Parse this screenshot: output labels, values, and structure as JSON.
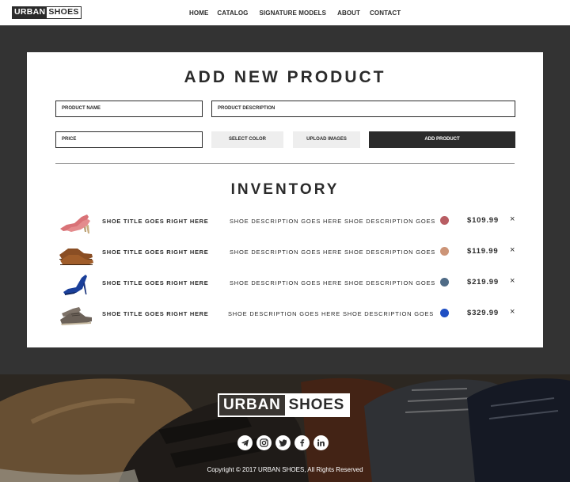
{
  "brand": {
    "part1": "URBAN",
    "part2": "SHOES"
  },
  "nav": {
    "items": [
      "HOME",
      "CATALOG",
      "SIGNATURE MODELS",
      "ABOUT",
      "CONTACT"
    ]
  },
  "add_form": {
    "title": "ADD NEW PRODUCT",
    "product_name_placeholder": "PRODUCT NAME",
    "product_description_placeholder": "PRODUCT DESCRIPTION",
    "price_placeholder": "PRICE",
    "select_color_label": "SELECT COLOR",
    "upload_images_label": "UPLOAD IMAGES",
    "add_product_label": "ADD PRODUCT"
  },
  "inventory": {
    "title": "INVENTORY",
    "items": [
      {
        "title": "SHOE TITLE GOES RIGHT HERE",
        "description": "SHOE DESCRIPTION GOES HERE SHOE DESCRIPTION GOES",
        "color": "#b85d63",
        "price": "$109.99",
        "remove": "×",
        "image": "pink-heel"
      },
      {
        "title": "SHOE TITLE GOES RIGHT HERE",
        "description": "SHOE DESCRIPTION GOES HERE SHOE DESCRIPTION GOES",
        "color": "#cc9477",
        "price": "$119.99",
        "remove": "×",
        "image": "brown-oxford"
      },
      {
        "title": "SHOE TITLE GOES RIGHT HERE",
        "description": "SHOE DESCRIPTION GOES HERE SHOE DESCRIPTION GOES",
        "color": "#4f6b86",
        "price": "$219.99",
        "remove": "×",
        "image": "blue-heel"
      },
      {
        "title": "SHOE TITLE GOES RIGHT HERE",
        "description": "SHOE DESCRIPTION GOES HERE SHOE DESCRIPTION GOES",
        "color": "#1f4fc4",
        "price": "$329.99",
        "remove": "×",
        "image": "grey-derby"
      }
    ]
  },
  "footer": {
    "socials": [
      "telegram-icon",
      "instagram-icon",
      "twitter-icon",
      "facebook-icon",
      "linkedin-icon"
    ],
    "copyright": "Copyright © 2017 URBAN SHOES, All Rights Reserved"
  }
}
